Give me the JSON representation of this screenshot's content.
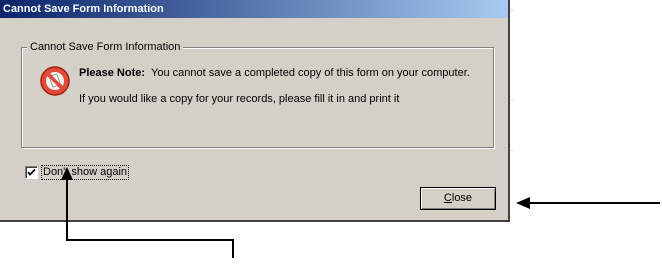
{
  "window": {
    "title": "Cannot Save Form Information"
  },
  "group": {
    "legend": "Cannot Save Form Information",
    "note_label": "Please Note:",
    "note_text": "You cannot save a completed copy of this form on your computer.",
    "message_line2": "If you would like a copy for your records, please fill it in and print it",
    "icon": "no-entry-icon"
  },
  "checkbox": {
    "label": "Don't show again",
    "checked": true
  },
  "buttons": {
    "close_accel": "C",
    "close_rest": "lose"
  },
  "annotations": {
    "arrow_color": "#000000"
  },
  "colors": {
    "dialog_bg": "#d4d0c8",
    "title_start": "#0a246a",
    "title_end": "#a6caf0"
  }
}
